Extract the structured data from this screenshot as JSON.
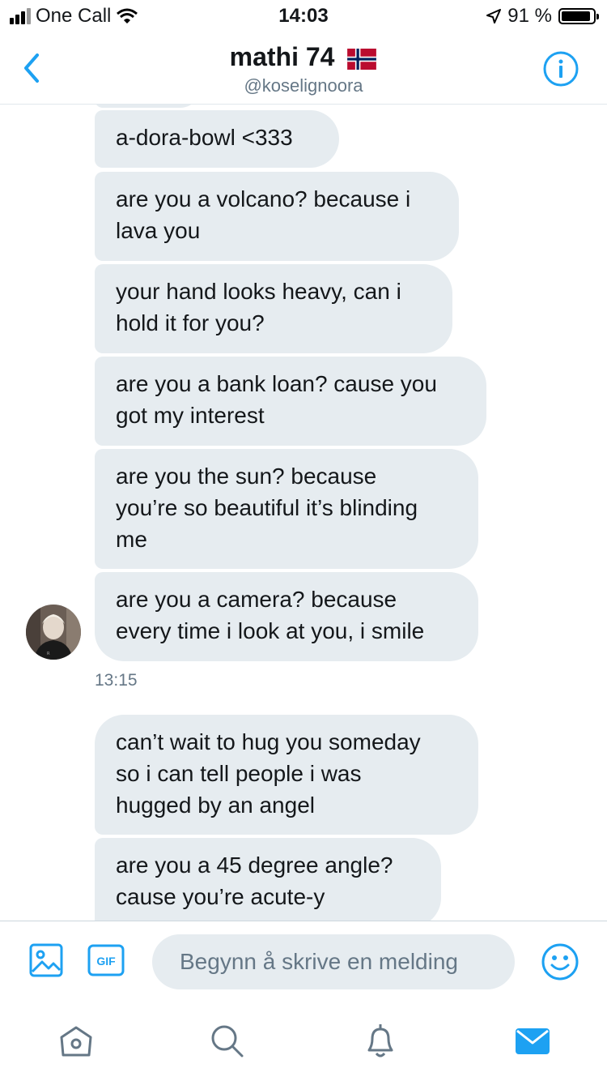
{
  "status_bar": {
    "carrier": "One Call",
    "time": "14:03",
    "battery_percent": "91 %",
    "battery_level": 0.91
  },
  "header": {
    "name": "mathi 74",
    "handle": "@koselignoora",
    "back_icon": "chevron-left-icon",
    "info_icon": "info-circle-icon",
    "flag_icon": "norway-flag-icon"
  },
  "messages": [
    {
      "text": "a-dora-bowl <333"
    },
    {
      "text": "are you a volcano? because i\nlava you"
    },
    {
      "text": "your hand looks heavy, can i\nhold it for you?"
    },
    {
      "text": "are you a bank loan? cause you\ngot my interest"
    },
    {
      "text": "are you the sun? because\nyou’re so beautiful it’s blinding\nme"
    },
    {
      "text": "are you a camera? because\nevery time i  look at you, i smile"
    },
    {
      "text": "can’t wait to hug you someday\nso i can tell people i was\nhugged by an angel"
    },
    {
      "text": "are you a 45 degree angle?\ncause you’re acute-y"
    }
  ],
  "timestamp": "13:15",
  "composer": {
    "placeholder": "Begynn å skrive en melding",
    "gif_label": "GIF"
  },
  "colors": {
    "accent": "#1da1f2",
    "bubble": "#e6ecf0",
    "secondary_text": "#657786"
  }
}
